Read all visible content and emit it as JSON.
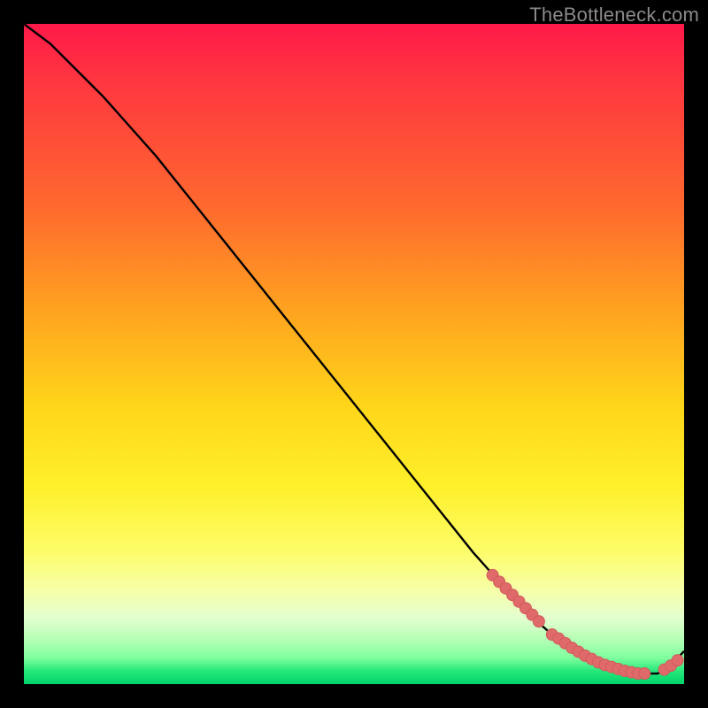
{
  "watermark": "TheBottleneck.com",
  "colors": {
    "curve_stroke": "#000000",
    "dot_fill": "#e06a6a",
    "dot_stroke": "#d15a5a"
  },
  "chart_data": {
    "type": "line",
    "title": "",
    "xlabel": "",
    "ylabel": "",
    "xlim": [
      0,
      100
    ],
    "ylim": [
      0,
      100
    ],
    "x": [
      0,
      4,
      8,
      12,
      16,
      20,
      24,
      28,
      32,
      36,
      40,
      44,
      48,
      52,
      56,
      60,
      64,
      68,
      72,
      76,
      80,
      84,
      88,
      92,
      96,
      98,
      100
    ],
    "values": [
      100,
      97,
      93,
      89,
      84.5,
      80,
      75,
      70,
      65,
      60,
      55,
      50,
      45,
      40,
      35,
      30,
      25,
      20,
      15.5,
      11,
      7.5,
      4.8,
      2.8,
      1.6,
      1.6,
      2.8,
      5
    ],
    "dot_clusters": [
      {
        "comment": "falling segment cluster",
        "points_xy": [
          [
            71,
            16.5
          ],
          [
            72,
            15.5
          ],
          [
            73,
            14.5
          ],
          [
            74,
            13.5
          ],
          [
            75,
            12.5
          ],
          [
            76,
            11.5
          ],
          [
            77,
            10.5
          ],
          [
            78,
            9.5
          ]
        ]
      },
      {
        "comment": "basin cluster dense",
        "points_xy": [
          [
            80,
            7.5
          ],
          [
            81,
            6.9
          ],
          [
            82,
            6.2
          ],
          [
            83,
            5.5
          ],
          [
            84,
            4.9
          ],
          [
            85,
            4.3
          ],
          [
            86,
            3.8
          ],
          [
            87,
            3.3
          ],
          [
            88,
            2.9
          ],
          [
            89,
            2.6
          ],
          [
            90,
            2.3
          ],
          [
            91,
            2.0
          ],
          [
            92,
            1.8
          ],
          [
            93,
            1.6
          ],
          [
            94,
            1.6
          ]
        ]
      },
      {
        "comment": "rising segment cluster",
        "points_xy": [
          [
            97,
            2.2
          ],
          [
            98,
            2.8
          ],
          [
            99,
            3.6
          ]
        ]
      }
    ]
  }
}
